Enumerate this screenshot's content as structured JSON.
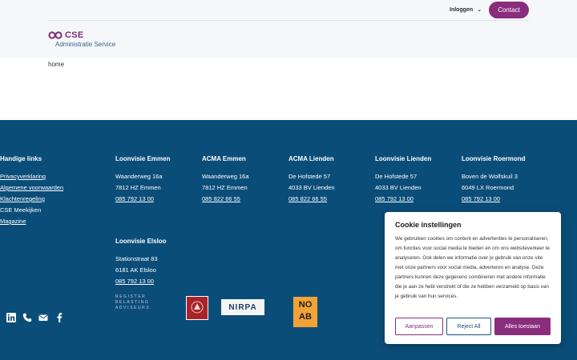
{
  "header": {
    "login_label": "Inloggen",
    "contact_label": "Contact",
    "logo_name": "CSE",
    "logo_sub": "Administratie Service"
  },
  "breadcrumb": "home",
  "footer": {
    "handy_links": {
      "title": "Handige links",
      "items": [
        "Privacyverklaring",
        "Algemene voorwaarden",
        "Klachtenregeling",
        "CSE Meekijken",
        "Magazine"
      ]
    },
    "offices": [
      {
        "title": "Loonvisie Emmen",
        "street": "Waanderweg 16a",
        "city": "7812 HZ Emmen",
        "phone": "085 792 13 00"
      },
      {
        "title": "ACMA Emmen",
        "street": "Waanderweg 16a",
        "city": "7812 HZ Emmen",
        "phone": "085 822 66 55"
      },
      {
        "title": "ACMA Lienden",
        "street": "De Hofstede 57",
        "city": "4033 BV Lienden",
        "phone": "085 822 66 55"
      },
      {
        "title": "Loonvisie Lienden",
        "street": "De Hofstede 57",
        "city": "4033 BV Lienden",
        "phone": "085 792 13 00"
      },
      {
        "title": "Loonvisie Roermond",
        "street": "Boven de Wolfskuil 3",
        "city": "6049 LX Roermond",
        "phone": "085 792 13 00"
      },
      {
        "title": "Loonvisie Elsloo",
        "street": "Stationstraat 83",
        "city": "6181 AK Elsloo",
        "phone": "085 792 13 00"
      }
    ],
    "social_icons": [
      "linkedin-icon",
      "phone-icon",
      "mail-icon",
      "facebook-icon"
    ],
    "certs": {
      "rb_lines": [
        "REGISTER",
        "BELASTING",
        "ADVISEURS"
      ],
      "nirpa": "NIRPA",
      "noab_top": "NO",
      "noab_bottom": "AB"
    }
  },
  "cookie": {
    "title": "Cookie instellingen",
    "text": "We gebruiken cookies om content en advertenties te personaliseren, om functies voor social media te bieden en om ons websiteverkeer te analyseren. Ook delen we informatie over je gebruik van onze site met onze partners voor social media, adverteren en analyse. Deze partners kunnen deze gegevens combineren met andere informatie die je aan ze hebt verstrekt of die ze hebben verzameld op basis van je gebruik van hun services.",
    "btn_adjust": "Aanpassen",
    "btn_reject": "Reject All",
    "btn_accept": "Alles toestaan"
  },
  "colors": {
    "brand_purple": "#8a2d7d",
    "footer_blue": "#0b4d79"
  }
}
